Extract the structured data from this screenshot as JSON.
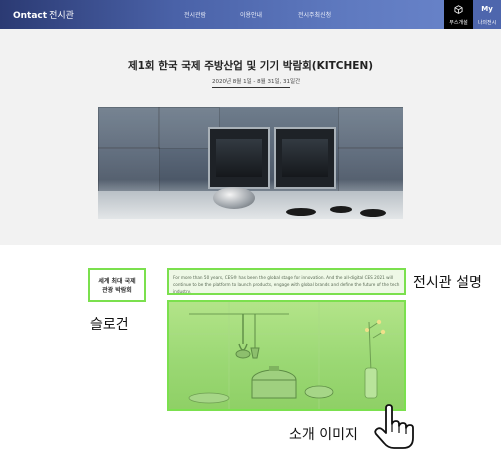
{
  "header": {
    "logo_bold": "Ontact",
    "logo_sub": "전시관",
    "nav": [
      "전시관람",
      "이용안내",
      "전시주최신청"
    ],
    "booth_label": "부스개설",
    "my_label": "My",
    "my_sub": "나의전시"
  },
  "hero": {
    "title": "제1회 한국 국제 주방산업 및 기기 박람회(KITCHEN)",
    "date": "2020년 8월 1일 - 8월 31일, 31일간"
  },
  "intro": {
    "slogan_lines": [
      "세계 최대 국제",
      "관광 박람회"
    ],
    "slogan_annotation": "슬로건",
    "description": "For more than 50 years, CES® has been the global stage for innovation. And the all-digital CES 2021 will continue to be the platform to launch products, engage with global brands and define the future of the tech industry.",
    "description_annotation": "전시관 설명",
    "image_annotation": "소개 이미지"
  },
  "colors": {
    "header_start": "#2b3a73",
    "header_end": "#6b86cc",
    "highlight": "#7be04e",
    "hero_bg": "#f2f2f2"
  },
  "icons": [
    "cube-icon",
    "pointing-hand-icon"
  ]
}
